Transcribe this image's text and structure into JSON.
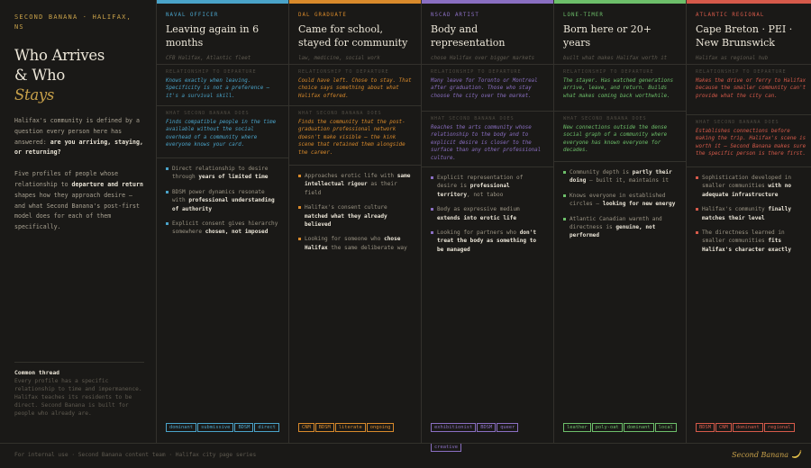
{
  "intro": {
    "kicker": "Second Banana · Halifax, NS",
    "title_line1": "Who Arrives",
    "title_line2": "& Who",
    "title_accent": "Stays",
    "para1_a": "Halifax's community is defined by a question every person here has answered: ",
    "para1_b": "are you arriving, staying, or returning?",
    "para2_a": "Five profiles of people whose relationship to ",
    "para2_b": "departure and return",
    "para2_c": " shapes how they approach desire — and what Second Banana's post-first model does for each of them specifically.",
    "thread_label": "Common thread",
    "thread_text": "Every profile has a specific relationship to time and impermanence. Halifax teaches its residents to be direct. Second Banana is built for people who already are."
  },
  "columns": [
    {
      "tag": "Naval officer",
      "title": "Leaving again in 6 months",
      "sub": "CFB Halifax, Atlantic fleet",
      "rel_label": "Relationship to departure",
      "rel_text": "Knows exactly when leaving. Specificity is not a preference — it's a survival skill.",
      "does_label": "What Second Banana does",
      "does_text": "Finds compatible people in the time available without the social overhead of a community where everyone knows your card.",
      "bullets": [
        [
          "Direct relationship to desire through ",
          "years of limited time",
          ""
        ],
        [
          "BDSM power dynamics resonate with ",
          "professional understanding of authority",
          ""
        ],
        [
          "Explicit consent gives hierarchy somewhere ",
          "chosen, not imposed",
          ""
        ]
      ],
      "tags": [
        "dominant",
        "submissive",
        "BDSM",
        "direct"
      ]
    },
    {
      "tag": "Dal graduate",
      "title": "Came for school, stayed for community",
      "sub": "law, medicine, social work",
      "rel_label": "Relationship to departure",
      "rel_text": "Could have left. Chose to stay. That choice says something about what Halifax offered.",
      "does_label": "What Second Banana does",
      "does_text": "Finds the community that the post-graduation professional network doesn't make visible — the kink scene that retained them alongside the career.",
      "bullets": [
        [
          "Approaches erotic life with ",
          "same intellectual rigour",
          " as their field"
        ],
        [
          "Halifax's consent culture ",
          "matched what they already believed",
          ""
        ],
        [
          "Looking for someone who ",
          "chose Halifax",
          " the same deliberate way"
        ]
      ],
      "tags": [
        "CNM",
        "BDSM",
        "literate",
        "ongoing"
      ]
    },
    {
      "tag": "NSCAD artist",
      "title": "Body and representation",
      "sub": "chose Halifax over bigger markets",
      "rel_label": "Relationship to departure",
      "rel_text": "Many leave for Toronto or Montreal after graduation. Those who stay choose the city over the market.",
      "does_label": "What Second Banana does",
      "does_text": "Reaches the arts community whose relationship to the body and to explicit desire is closer to the surface than any other professional culture.",
      "bullets": [
        [
          "Explicit representation of desire is ",
          "professional territory",
          ", not taboo"
        ],
        [
          "Body as expressive medium ",
          "extends into erotic life",
          ""
        ],
        [
          "Looking for partners who ",
          "don't treat the body as something to be managed",
          ""
        ]
      ],
      "tags": [
        "exhibitionist",
        "BDSM",
        "queer",
        "creative"
      ]
    },
    {
      "tag": "Lone-timer",
      "title": "Born here or 20+ years",
      "sub": "built what makes Halifax worth it",
      "rel_label": "Relationship to departure",
      "rel_text": "The stayer. Has watched generations arrive, leave, and return. Builds what makes coming back worthwhile.",
      "does_label": "What Second Banana does",
      "does_text": "New connections outside the dense social graph of a community where everyone has known everyone for decades.",
      "bullets": [
        [
          "Community depth is ",
          "partly their doing",
          " — built it, maintains it"
        ],
        [
          "Knows everyone in established circles — ",
          "looking for new energy",
          ""
        ],
        [
          "Atlantic Canadian warmth and directness is ",
          "genuine, not performed",
          ""
        ]
      ],
      "tags": [
        "leather",
        "poly-oat",
        "dominant",
        "local"
      ]
    },
    {
      "tag": "Atlantic regional",
      "title": "Cape Breton · PEI · New Brunswick",
      "sub": "Halifax as regional hub",
      "rel_label": "Relationship to departure",
      "rel_text": "Makes the drive or ferry to Halifax because the smaller community can't provide what the city can.",
      "does_label": "What Second Banana does",
      "does_text": "Establishes connections before making the trip. Halifax's scene is worth it — Second Banana makes sure the specific person is there first.",
      "bullets": [
        [
          "Sophistication developed in smaller communities ",
          "with no adequate infrastructure",
          ""
        ],
        [
          "Halifax's community ",
          "finally matches their level",
          ""
        ],
        [
          "The directness learned in smaller communities ",
          "fits Halifax's character exactly",
          ""
        ]
      ],
      "tags": [
        "BDSM",
        "CNM",
        "dominant",
        "regional"
      ]
    }
  ],
  "colors": [
    "#4aa3c9",
    "#d98a2b",
    "#8a6fc2",
    "#6dbf6a",
    "#d65a4a"
  ],
  "footer": {
    "text": "For internal use · Second Banana content team · Halifax city page series",
    "brand": "Second Banana"
  }
}
